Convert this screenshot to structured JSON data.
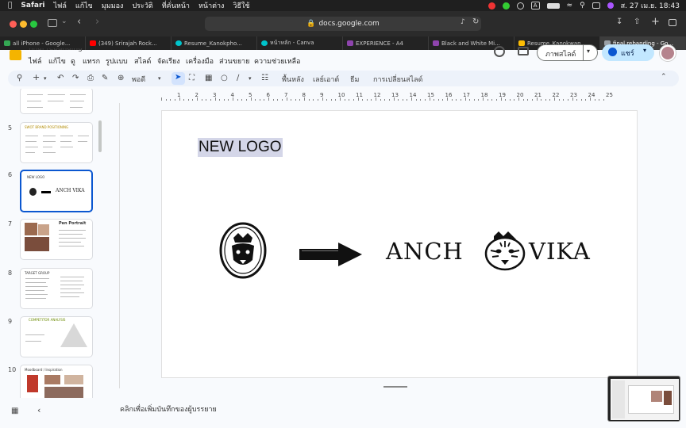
{
  "menubar": {
    "app": "Safari",
    "items": [
      "ไฟล์",
      "แก้ไข",
      "มุมมอง",
      "ประวัติ",
      "ที่คั่นหน้า",
      "หน้าต่าง",
      "วิธีใช้"
    ],
    "clock": "ส. 27 เม.ย. 18:43",
    "input_lang": "A"
  },
  "browser": {
    "url": "docs.google.com",
    "tabs": [
      {
        "label": "all iPhone - Google...",
        "color": "#34a853"
      },
      {
        "label": "(349) Srirajah Rock...",
        "color": "#ff0000"
      },
      {
        "label": "Resume_Kanokpho...",
        "color": "#00c4cc"
      },
      {
        "label": "หน้าหลัก - Canva",
        "color": "#00c4cc"
      },
      {
        "label": "EXPERIENCE - A4",
        "color": "#8e44ad"
      },
      {
        "label": "Black and White Mi...",
        "color": "#8e44ad"
      },
      {
        "label": "Resume_Kanokwan...",
        "color": "#fbbc04"
      },
      {
        "label": "final rebanding - Go...",
        "color": "#fbbc04"
      }
    ]
  },
  "slides": {
    "doc_title": "final rebanding",
    "menu": [
      "ไฟล์",
      "แก้ไข",
      "ดู",
      "แทรก",
      "รูปแบบ",
      "สไลด์",
      "จัดเรียง",
      "เครื่องมือ",
      "ส่วนขยาย",
      "ความช่วยเหลือ"
    ],
    "present_label": "ภาพสไลด์",
    "share_label": "แชร์",
    "toolbar": {
      "zoom": "พอดี",
      "background": "พื้นหลัง",
      "layout": "เลย์เอาต์",
      "theme": "ธีม",
      "transition": "การเปลี่ยนสไลด์"
    },
    "ruler_ticks": [
      "1",
      "2",
      "3",
      "4",
      "5",
      "6",
      "7",
      "8",
      "9",
      "10",
      "11",
      "12",
      "13",
      "14",
      "15",
      "16",
      "17",
      "18",
      "19",
      "20",
      "21",
      "22",
      "23",
      "24",
      "25"
    ],
    "thumbnails": [
      {
        "num": "5",
        "title": "SWOT BRAND POSITIONING"
      },
      {
        "num": "6",
        "title": "NEW LOGO",
        "mini": "ANCH VIKA"
      },
      {
        "num": "7",
        "title": "Pen Portrait"
      },
      {
        "num": "8",
        "title": "TARGET GROUP"
      },
      {
        "num": "9",
        "title": "COMPETITOR ANALYSIS"
      },
      {
        "num": "10",
        "title": "Moodboard / Inspiration"
      }
    ],
    "current_slide": {
      "title": "NEW LOGO",
      "brand_left": "ANCH",
      "brand_right": "VIKA"
    },
    "notes_placeholder": "คลิกเพื่อเพิ่มบันทึกของผู้บรรยาย"
  }
}
